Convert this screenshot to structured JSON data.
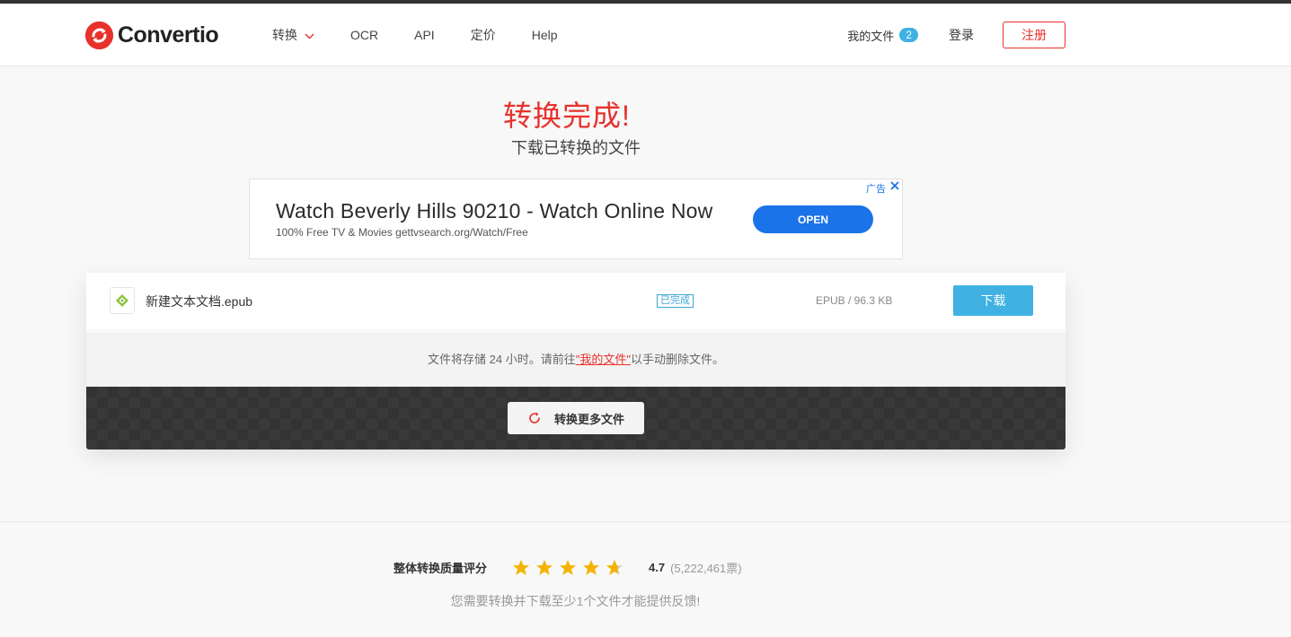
{
  "header": {
    "logo_text": "Convertio",
    "nav": [
      {
        "label": "转换",
        "has_dropdown": true
      },
      {
        "label": "OCR"
      },
      {
        "label": "API"
      },
      {
        "label": "定价"
      },
      {
        "label": "Help"
      }
    ],
    "my_files_label": "我的文件",
    "my_files_count": "2",
    "login_label": "登录",
    "register_label": "注册"
  },
  "main": {
    "title": "转换完成!",
    "subtitle": "下载已转换的文件"
  },
  "ad": {
    "title": "Watch Beverly Hills 90210 - Watch Online Now",
    "subtitle": "100% Free TV & Movies gettvsearch.org/Watch/Free",
    "button_label": "OPEN",
    "tag": "广告"
  },
  "file": {
    "name": "新建文本文档.epub",
    "status": "已完成",
    "size": "EPUB / 96.3 KB",
    "download_label": "下载"
  },
  "storage_note": {
    "before": "文件将存储 24 小时。请前往",
    "link": "\"我的文件\"",
    "after": "以手动删除文件。"
  },
  "convert_more_label": "转换更多文件",
  "rating": {
    "label": "整体转换质量评分",
    "score": "4.7",
    "votes": "(5,222,461票)",
    "stars_value": 4.7,
    "stars_max": 5
  },
  "feedback_note": "您需要转换并下载至少1个文件才能提供反馈!",
  "colors": {
    "brand_red": "#e8312c",
    "accent_blue": "#3fb1e2",
    "star_gold": "#f5b301"
  }
}
